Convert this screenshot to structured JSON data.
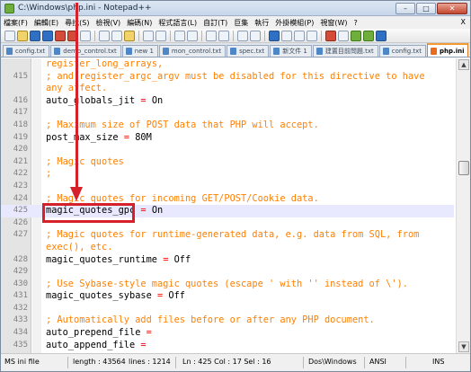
{
  "window": {
    "title": "C:\\Windows\\php.ini - Notepad++",
    "minimize": "–",
    "maximize": "□",
    "close": "✕"
  },
  "menu": {
    "items": [
      "檔案(F)",
      "編輯(E)",
      "尋找(S)",
      "檢視(V)",
      "編碼(N)",
      "程式語言(L)",
      "自訂(T)",
      "巨集",
      "執行",
      "外掛模組(P)",
      "視窗(W)",
      "?"
    ],
    "close_label": "X"
  },
  "toolbar": {
    "icons": [
      "new-file-icon",
      "open-file-icon",
      "save-icon",
      "save-all-icon",
      "close-icon",
      "close-all-icon",
      "print-icon",
      "cut-icon",
      "copy-icon",
      "paste-icon",
      "undo-icon",
      "redo-icon",
      "find-icon",
      "replace-icon",
      "zoom-in-icon",
      "zoom-out-icon",
      "sync-v-icon",
      "sync-h-icon",
      "word-wrap-icon",
      "show-all-icon",
      "indent-guide-icon",
      "doc-map-icon",
      "record-macro-icon",
      "stop-record-icon",
      "play-macro-icon",
      "run-macro-icon",
      "save-macro-icon"
    ]
  },
  "tabs": [
    {
      "label": "config.txt",
      "active": false
    },
    {
      "label": "demo_control.txt",
      "active": false
    },
    {
      "label": "new 1",
      "active": false
    },
    {
      "label": "mon_control.txt",
      "active": false
    },
    {
      "label": "spec.txt",
      "active": false
    },
    {
      "label": "新文件 1",
      "active": false
    },
    {
      "label": "建置目前問題.txt",
      "active": false
    },
    {
      "label": "config.txt",
      "active": false
    },
    {
      "label": "php.ini",
      "active": true
    }
  ],
  "editor": {
    "lines": [
      {
        "num": "",
        "text": "register_long_arrays,",
        "kind": "comment"
      },
      {
        "num": "415",
        "text": "; and register_argc_argv must be disabled for this directive to have",
        "kind": "comment"
      },
      {
        "num": "",
        "text": "any affect.",
        "kind": "comment"
      },
      {
        "num": "416",
        "key": "auto_globals_jit",
        "value": "On",
        "kind": "setting"
      },
      {
        "num": "417",
        "text": "",
        "kind": "blank"
      },
      {
        "num": "418",
        "text": "; Maximum size of POST data that PHP will accept.",
        "kind": "comment"
      },
      {
        "num": "419",
        "key": "post_max_size",
        "value": "80M",
        "kind": "setting"
      },
      {
        "num": "420",
        "text": "",
        "kind": "blank"
      },
      {
        "num": "421",
        "text": "; Magic quotes",
        "kind": "comment"
      },
      {
        "num": "422",
        "text": ";",
        "kind": "comment"
      },
      {
        "num": "423",
        "text": "",
        "kind": "blank"
      },
      {
        "num": "424",
        "text": "; Magic quotes for incoming GET/POST/Cookie data.",
        "kind": "comment"
      },
      {
        "num": "425",
        "key": "magic_quotes_gpc",
        "value": "On",
        "kind": "setting",
        "current": true
      },
      {
        "num": "426",
        "text": "",
        "kind": "blank"
      },
      {
        "num": "427",
        "text": "; Magic quotes for runtime-generated data, e.g. data from SQL, from",
        "kind": "comment"
      },
      {
        "num": "",
        "text": "exec(), etc.",
        "kind": "comment"
      },
      {
        "num": "428",
        "key": "magic_quotes_runtime",
        "value": "Off",
        "kind": "setting"
      },
      {
        "num": "429",
        "text": "",
        "kind": "blank"
      },
      {
        "num": "430",
        "text": "; Use Sybase-style magic quotes (escape ' with '' instead of \\').",
        "kind": "comment"
      },
      {
        "num": "431",
        "key": "magic_quotes_sybase",
        "value": "Off",
        "kind": "setting"
      },
      {
        "num": "432",
        "text": "",
        "kind": "blank"
      },
      {
        "num": "433",
        "text": "; Automatically add files before or after any PHP document.",
        "kind": "comment"
      },
      {
        "num": "434",
        "key": "auto_prepend_file",
        "value": "",
        "kind": "setting"
      },
      {
        "num": "435",
        "key": "auto_append_file",
        "value": "",
        "kind": "setting"
      }
    ]
  },
  "statusbar": {
    "file_type": "MS ini file",
    "length": "length : 43564",
    "lines": "lines : 1214",
    "cursor": "Ln : 425   Col : 17   Sel : 16",
    "eol": "Dos\\Windows",
    "encoding": "ANSI",
    "mode": "INS"
  },
  "annotation": {
    "color": "#d6202a"
  }
}
